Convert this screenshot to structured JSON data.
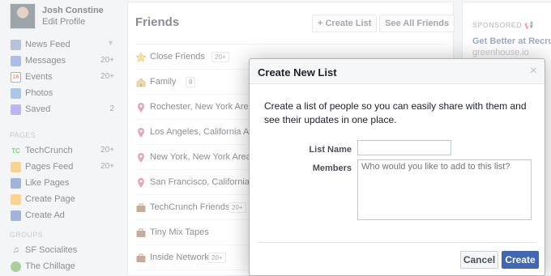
{
  "profile": {
    "name": "Josh Constine",
    "edit_label": "Edit Profile"
  },
  "nav": [
    {
      "label": "News Feed",
      "count": "",
      "icon": "news-feed-icon",
      "color": "#6d84b4"
    },
    {
      "label": "Messages",
      "count": "20+",
      "icon": "messages-icon",
      "color": "#5b7bd5"
    },
    {
      "label": "Events",
      "count": "20+",
      "icon": "events-icon",
      "color": "#ffffff"
    },
    {
      "label": "Photos",
      "count": "",
      "icon": "photos-icon",
      "color": "#4a90d9"
    },
    {
      "label": "Saved",
      "count": "2",
      "icon": "saved-icon",
      "color": "#7b68ee"
    }
  ],
  "events_icon_text": "16",
  "pages_header": "PAGES",
  "pages": [
    {
      "label": "TechCrunch",
      "count": "20+",
      "icon": "techcrunch-icon",
      "color": "#0a9e01"
    },
    {
      "label": "Pages Feed",
      "count": "20+",
      "icon": "pages-feed-icon",
      "color": "#f5a623"
    },
    {
      "label": "Like Pages",
      "count": "",
      "icon": "like-pages-icon",
      "color": "#4267b2"
    },
    {
      "label": "Create Page",
      "count": "",
      "icon": "create-page-icon",
      "color": "#f5a623"
    },
    {
      "label": "Create Ad",
      "count": "",
      "icon": "create-ad-icon",
      "color": "#4267b2"
    }
  ],
  "tc_icon_text": "TC",
  "groups_header": "GROUPS",
  "groups": [
    {
      "label": "SF Socialites",
      "icon": "music-note-icon"
    },
    {
      "label": "The Chillage",
      "icon": "leaf-icon"
    }
  ],
  "friends": {
    "title": "Friends",
    "create_list_label": "+ Create List",
    "see_all_label": "See All Friends",
    "lists": [
      {
        "name": "Close Friends",
        "badge": "20+",
        "icon": "star-icon"
      },
      {
        "name": "Family",
        "badge": "8",
        "icon": "house-icon"
      },
      {
        "name": "Rochester, New York Area",
        "badge": "",
        "icon": "location-pin-icon"
      },
      {
        "name": "Los Angeles, California Area",
        "badge": "",
        "icon": "location-pin-icon"
      },
      {
        "name": "New York, New York Area",
        "badge": "",
        "icon": "location-pin-icon"
      },
      {
        "name": "San Francisco, California Area",
        "badge": "",
        "icon": "location-pin-icon"
      },
      {
        "name": "TechCrunch Friends",
        "badge": "20+",
        "icon": "briefcase-icon"
      },
      {
        "name": "Tiny Mix Tapes",
        "badge": "",
        "icon": "briefcase-icon"
      },
      {
        "name": "Inside Network",
        "badge": "20+",
        "icon": "briefcase-icon"
      }
    ]
  },
  "ads": {
    "sponsored_label": "SPONSORED",
    "title": "Get Better at Recruiting",
    "url": "greenhouse.io"
  },
  "dialog": {
    "title": "Create New List",
    "close_glyph": "×",
    "description": "Create a list of people so you can easily share with them and see their updates in one place.",
    "list_name_label": "List Name",
    "list_name_value": "",
    "members_label": "Members",
    "members_placeholder": "Who would you like to add to this list?",
    "cancel_label": "Cancel",
    "create_label": "Create"
  },
  "colors": {
    "brand_blue": "#4267b2",
    "link_blue": "#365899",
    "background": "#e9eaed"
  }
}
